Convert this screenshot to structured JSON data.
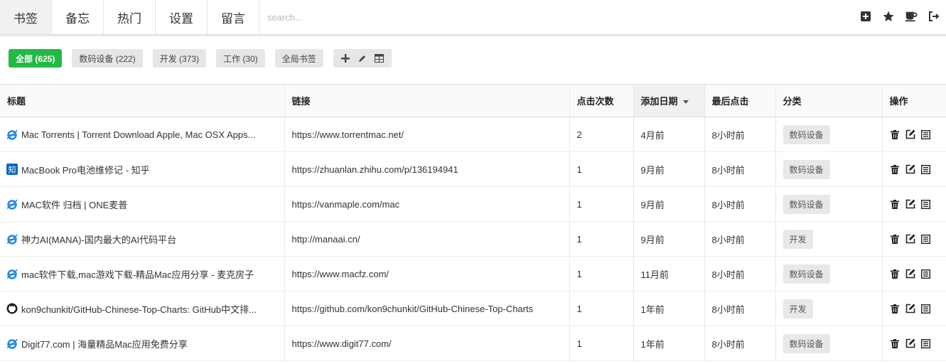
{
  "nav": {
    "tabs": [
      "书签",
      "备忘",
      "热门",
      "设置",
      "留言"
    ],
    "search_placeholder": "search...",
    "right_icons": [
      "plus-square-icon",
      "star-icon",
      "coffee-icon",
      "sign-out-icon"
    ]
  },
  "filters": {
    "items": [
      {
        "label": "全部 (625)",
        "active": true
      },
      {
        "label": "数码设备 (222)",
        "active": false
      },
      {
        "label": "开发 (373)",
        "active": false
      },
      {
        "label": "工作 (30)",
        "active": false
      },
      {
        "label": "全局书签",
        "active": false
      }
    ],
    "tool_icons": [
      "plus-icon",
      "pencil-icon",
      "table-icon"
    ]
  },
  "table": {
    "headers": [
      "标题",
      "链接",
      "点击次数",
      "添加日期",
      "最后点击",
      "分类",
      "操作"
    ],
    "sorted_column": "添加日期",
    "rows": [
      {
        "icon": "ie-icon",
        "title": "Mac Torrents | Torrent Download Apple, Mac OSX Apps...",
        "url": "https://www.torrentmac.net/",
        "clicks": "2",
        "added": "4月前",
        "last": "8小时前",
        "category": "数码设备"
      },
      {
        "icon": "zhihu-icon",
        "title": "MacBook Pro电池维修记 - 知乎",
        "url": "https://zhuanlan.zhihu.com/p/136194941",
        "clicks": "1",
        "added": "9月前",
        "last": "8小时前",
        "category": "数码设备"
      },
      {
        "icon": "ie-icon",
        "title": "MAC软件 归档 | ONE麦普",
        "url": "https://vanmaple.com/mac",
        "clicks": "1",
        "added": "9月前",
        "last": "8小时前",
        "category": "数码设备"
      },
      {
        "icon": "ie-icon",
        "title": "神力AI(MANA)-国内最大的AI代码平台",
        "url": "http://manaai.cn/",
        "clicks": "1",
        "added": "9月前",
        "last": "8小时前",
        "category": "开发"
      },
      {
        "icon": "ie-icon",
        "title": "mac软件下载,mac游戏下载-精品Mac应用分享 - 麦克房子",
        "url": "https://www.macfz.com/",
        "clicks": "1",
        "added": "11月前",
        "last": "8小时前",
        "category": "数码设备"
      },
      {
        "icon": "github-icon",
        "title": "kon9chunkit/GitHub-Chinese-Top-Charts: GitHub中文排...",
        "url": "https://github.com/kon9chunkit/GitHub-Chinese-Top-Charts",
        "clicks": "1",
        "added": "1年前",
        "last": "8小时前",
        "category": "开发"
      },
      {
        "icon": "ie-icon",
        "title": "Digit77.com | 海量精品Mac应用免费分享",
        "url": "https://www.digit77.com/",
        "clicks": "1",
        "added": "1年前",
        "last": "8小时前",
        "category": "数码设备"
      }
    ],
    "row_action_icons": [
      "trash-icon",
      "edit-icon",
      "list-icon"
    ]
  },
  "colors": {
    "accent": "#21ba45",
    "ie_blue": "#1e88e5",
    "zhihu_blue": "#0a66c2"
  }
}
